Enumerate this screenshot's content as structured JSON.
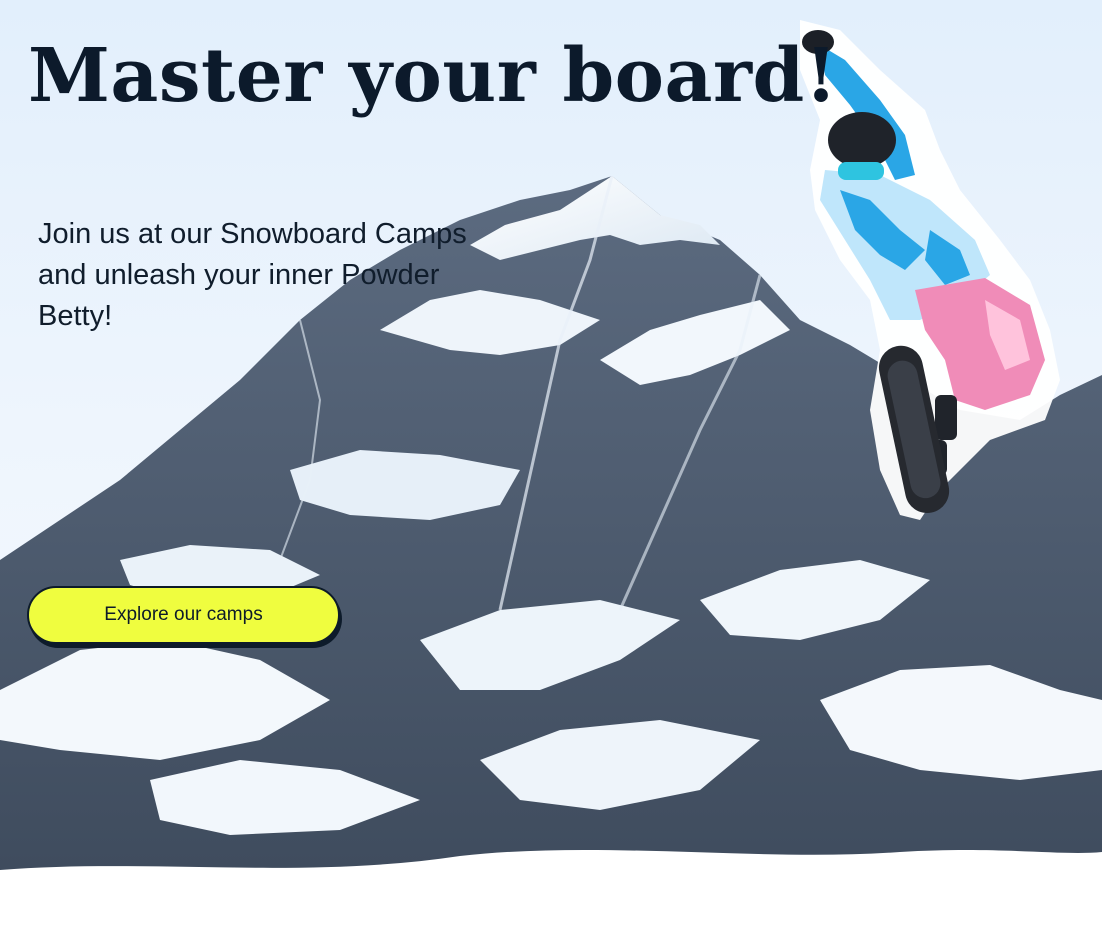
{
  "hero": {
    "title": "Master your board!",
    "tagline": "Join us at our Snowboard Camps and unleash your inner Powder Betty!",
    "cta_label": "Explore our camps"
  },
  "colors": {
    "title_text": "#0c1a2b",
    "cta_background": "#effd3f",
    "cta_border": "#0d1b2a",
    "sky": "#e2effc",
    "snow": "#ffffff",
    "rock": "#4a5a6e",
    "jacket_blue": "#2aa6e6",
    "pants_pink": "#f08cb8",
    "board": "#26292f"
  },
  "images": {
    "mountain": "snowy-mountain-peak",
    "rider": "snowboarder-jumping"
  }
}
